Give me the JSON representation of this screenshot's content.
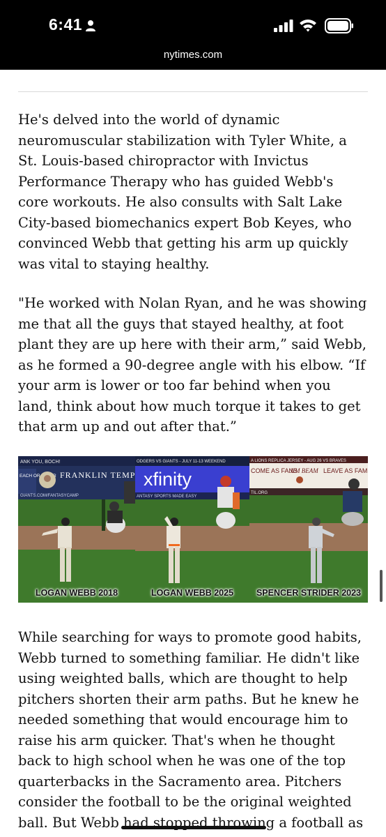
{
  "status_bar": {
    "time": "6:41",
    "icons": [
      "person-icon",
      "cellular-signal-icon",
      "wifi-icon",
      "battery-icon"
    ]
  },
  "browser": {
    "url": "nytimes.com"
  },
  "article": {
    "paragraph_1": "He's delved into the world of dynamic neuromuscular stabilization with Tyler White, a St. Louis-based chiropractor with Invictus Performance Therapy who has guided Webb's core workouts. He also consults with Salt Lake City-based biomechanics expert Bob Keyes, who convinced Webb that getting his arm up quickly was vital to staying healthy.",
    "paragraph_2": "\"He worked with Nolan Ryan, and he was showing me that all the guys that stayed healthy, at foot plant they are up here with their arm,” said Webb, as he formed a 90-degree angle with his elbow. “If your arm is lower or too far behind when you land, think about how much torque it takes to get that arm up and out after that.”",
    "paragraph_3": "While searching for ways to promote good habits, Webb turned to something familiar. He didn't like using weighted balls, which are thought to help pitchers shorten their arm paths. But he knew he needed something that would encourage him to raise his arm quicker. That's when he thought back to high school when he was one of the top quarterbacks in the Sacramento area. Pitchers consider the football to be the original weighted ball. But Webb had stopped throwing a football as"
  },
  "photo": {
    "panels": [
      {
        "caption": "LOGAN WEBB 2018",
        "signage_top": "ANK YOU, BOCH!",
        "signage_left": "EACH OR ETTER",
        "signage_brand": "FRANKLIN TEMPLETON",
        "signage_bottom": "GIANTS.COM/FANTASYCAMP"
      },
      {
        "caption": "LOGAN WEBB 2025",
        "signage_top": "ODGERS VS GIANTS - JULY 11-13 WEEKEND",
        "signage_brand": "xfinity",
        "signage_bottom": "ANTASY SPORTS MADE EASY"
      },
      {
        "caption": "SPENCER STRIDER 2023",
        "signage_top": "A LIONS REPLICA JERSEY - AUG 26 VS BRAVES",
        "signage_left": "COME AS FANS",
        "signage_brand": "JIM BEAM",
        "signage_right": "LEAVE AS FAMILY",
        "signage_bottom": "TIL.ORG"
      }
    ]
  },
  "colors": {
    "status_bar_bg": "#000000",
    "page_bg": "#ffffff",
    "body_text": "#121212",
    "xfinity_panel": "#3a3fd0",
    "grass": "#3f7a2c",
    "dirt": "#9a7358"
  }
}
